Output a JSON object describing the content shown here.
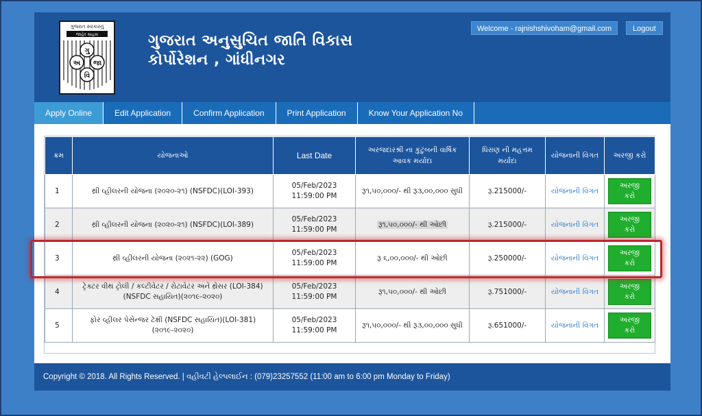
{
  "header": {
    "org_line1": "ગુજરાત અનુસુચિત જાતિ વિકાસ",
    "org_line2": "કોર્પોરેશન , ગાંધીનગર",
    "logo_top_text": "ગુજરાત સરકારનું",
    "logo_sub_text": "જાહેર સાહસ",
    "logo_letters": [
      "ગુ",
      "અ",
      "જા",
      "વિ"
    ],
    "welcome": "Welcome - rajnishshivoham@gmail.com",
    "logout": "Logout"
  },
  "nav": [
    {
      "label": "Apply Online",
      "active": true
    },
    {
      "label": "Edit Application",
      "active": false
    },
    {
      "label": "Confirm Application",
      "active": false
    },
    {
      "label": "Print Application",
      "active": false
    },
    {
      "label": "Know Your Application No",
      "active": false
    }
  ],
  "table": {
    "headers": [
      "ક્રમ",
      "યોજનાઓ",
      "Last Date",
      "અરજદારશ્રી ના કુંટુંબની વાર્ષિક આવક મર્યાદા",
      "ધિરાણ ની મહત્તમ મર્યાદા",
      "યોજનાની વિગત",
      "અરજી કરો"
    ],
    "rows": [
      {
        "sn": "1",
        "scheme": "થ્રી વ્હીલરની યોજના (૨૦૨૦-૨૧) (NSFDC)(LOI-393)",
        "date": "05/Feb/2023",
        "time": "11:59:00 PM",
        "income": "રૂ૧,૫૦,૦૦૦/- થી રૂ૩,૦૦,૦૦૦ સુધી",
        "loan": "રૂ.215000/-",
        "details": "યોજનાની વિગત",
        "apply": "અરજી કરો"
      },
      {
        "sn": "2",
        "scheme": "થ્રી વ્હીલરની યોજના (૨૦૨૦-૨૧) (NSFDC)(LOI-389)",
        "date": "05/Feb/2023",
        "time": "11:59:00 PM",
        "income": "રૂ૧,૫૦,૦૦૦/- થી ઓછી",
        "loan": "રૂ.215000/-",
        "details": "યોજનાની વિગત",
        "apply": "અરજી કરો"
      },
      {
        "sn": "3",
        "scheme": "થ્રી વ્હીલરની યોજના (૨૦૨૧-૨૨) (GOG)",
        "date": "05/Feb/2023",
        "time": "11:59:00 PM",
        "income": "રૂ ૬,૦૦,૦૦૦/- થી ઓછી",
        "loan": "રૂ.250000/-",
        "details": "યોજનાની વિગત",
        "apply": "અરજી કરો"
      },
      {
        "sn": "4",
        "scheme": "ટ્રેક્ટર વીથ ટ્રોલી / કલ્ટીવેટર / રોટાવેટર અને થ્રેસર (LOI-384) (NSFDC સહાયિત)(૨૦૧૯-૨૦૨૦)",
        "date": "05/Feb/2023",
        "time": "11:59:00 PM",
        "income": "રૂ૧,૫૦,૦૦૦/- થી ઓછી",
        "loan": "રૂ.751000/-",
        "details": "યોજનાની વિગત",
        "apply": "અરજી કરો"
      },
      {
        "sn": "5",
        "scheme": "ફોર વ્હીલર પેસેન્જર ટેક્ષી (NSFDC સહાયિત)(LOI-381) (૨૦૧૯-૨૦૨૦)",
        "date": "05/Feb/2023",
        "time": "11:59:00 PM",
        "income": "રૂ૧,૫૦,૦૦૦/- થી રૂ૩,૦૦,૦૦૦ સુધી",
        "loan": "રૂ.651000/-",
        "details": "યોજનાની વિગત",
        "apply": "અરજી કરો"
      }
    ]
  },
  "footer": {
    "text": "Copyright © 2018. All Rights Reserved.  |  વહીવટી હેલ્પલાઈન : (079)23257552 (11:00 am to 6:00 pm Monday to Friday)"
  },
  "colors": {
    "header_bg": "#1d559c",
    "nav_bg": "#1a6cb9",
    "apply_button": "#1fae2d",
    "highlight": "#c0262c"
  }
}
